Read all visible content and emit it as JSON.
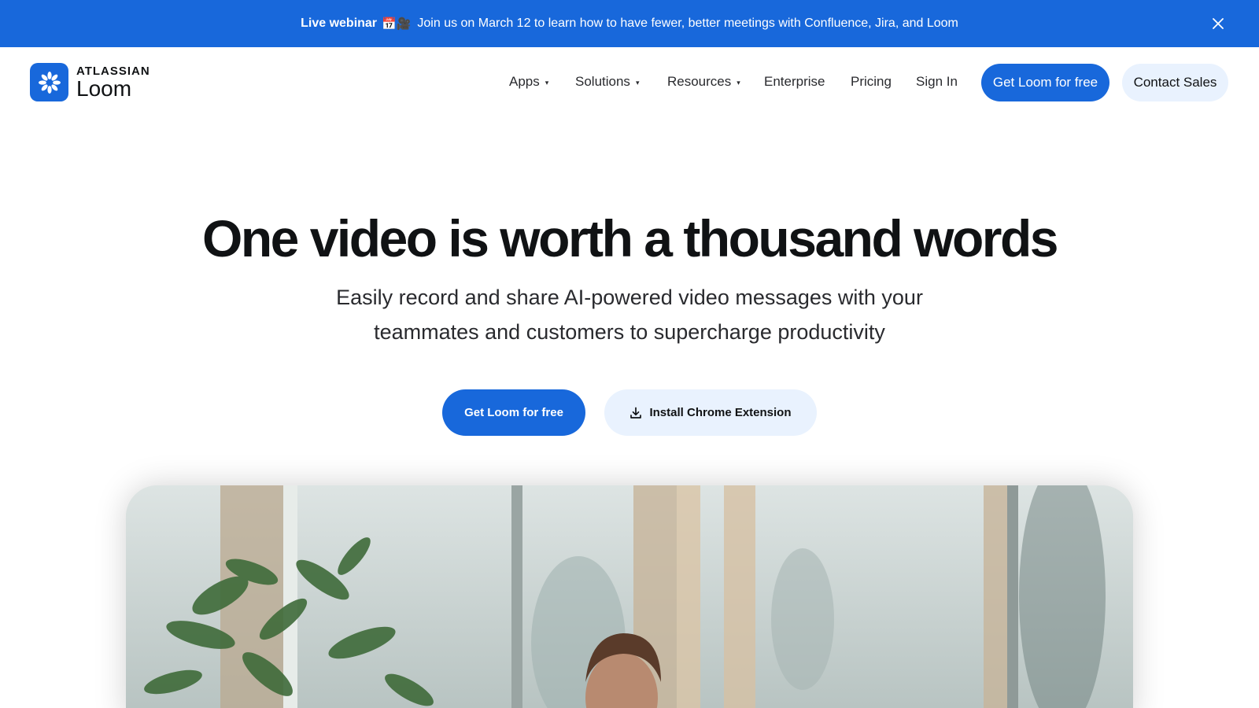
{
  "banner": {
    "bold_text": "Live webinar",
    "emoji": "📅🎥",
    "message": "Join us on March 12 to learn how to have fewer, better meetings with Confluence, Jira, and Loom",
    "close_icon": "close-icon",
    "bg_color": "#1868DB"
  },
  "header": {
    "logo": {
      "brand": "ATLASSIAN",
      "product": "Loom",
      "icon": "loom-logo-icon"
    },
    "nav": [
      {
        "label": "Apps",
        "caret": "▾"
      },
      {
        "label": "Solutions",
        "caret": "▾"
      },
      {
        "label": "Resources",
        "caret": "▾"
      },
      {
        "label": "Enterprise"
      },
      {
        "label": "Pricing"
      },
      {
        "label": "Sign In"
      }
    ],
    "cta_primary": "Get Loom for free",
    "cta_secondary": "Contact Sales"
  },
  "hero": {
    "title": "One video is worth a thousand words",
    "subtitle_line1": "Easily record and share AI-powered video messages with your",
    "subtitle_line2": "teammates and customers to supercharge productivity",
    "primary_button": "Get Loom for free",
    "secondary_button": "Install Chrome Extension",
    "secondary_icon": "download-icon"
  },
  "colors": {
    "accent": "#1868DB",
    "secondary_button_bg": "#E9F2FE",
    "text_dark": "#101214"
  }
}
